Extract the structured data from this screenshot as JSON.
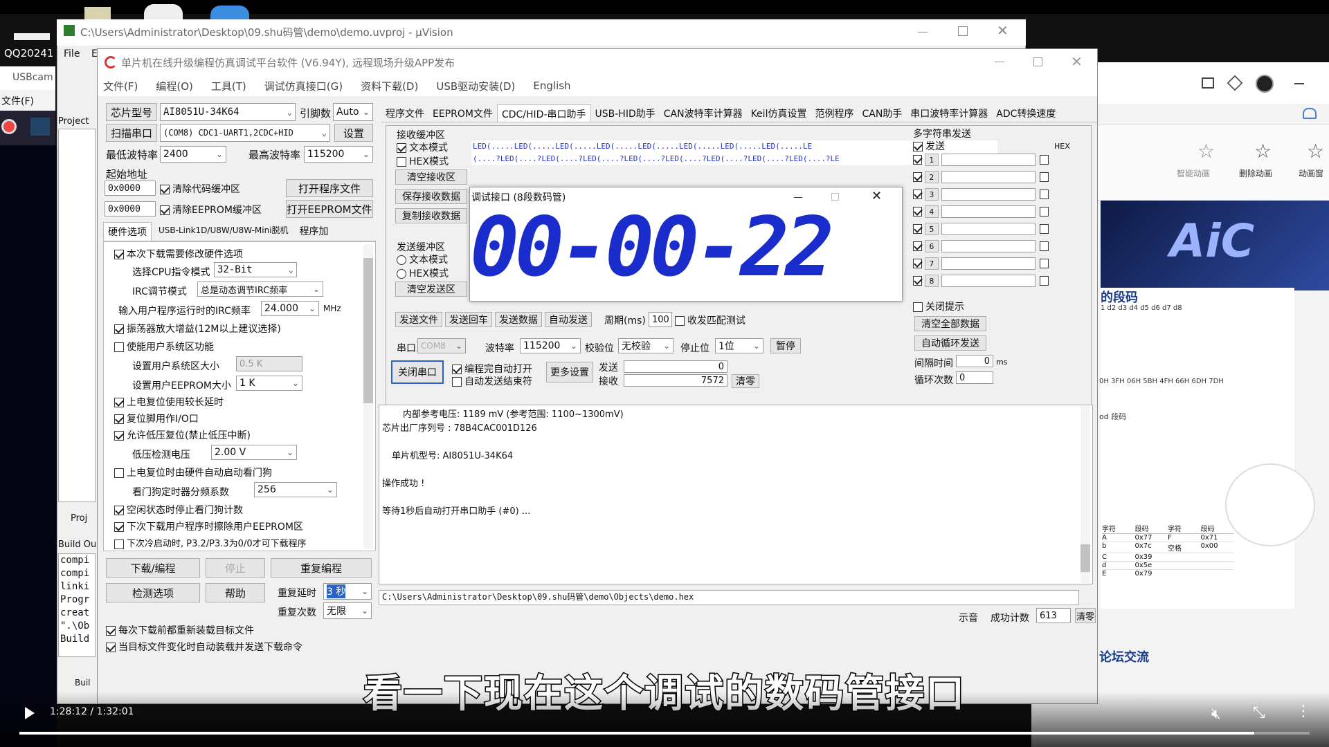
{
  "desktop": {
    "qq_label": "QQ20241",
    "usbcam_label": "USBcam",
    "filemenu": "文件(F)",
    "settings": "设"
  },
  "uv": {
    "title": "C:\\Users\\Administrator\\Desktop\\09.shu码管\\demo\\demo.uvproj - µVision",
    "menu_file": "File",
    "menu_e": "E",
    "project": "Project",
    "build": "Build Ou",
    "proj_tab": "Proj",
    "build_lines": [
      "compi",
      "compi",
      "linki",
      "Progr",
      "creat",
      "\".\\Ob",
      "Build"
    ],
    "build_tab": "Buil"
  },
  "stc": {
    "title": "单片机在线升级编程仿真调试平台软件 (V6.94Y), 远程现场升级APP发布",
    "menu": [
      "文件(F)",
      "编程(O)",
      "工具(T)",
      "调试仿真接口(G)",
      "资料下载(D)",
      "USB驱动安装(D)",
      "English"
    ],
    "chip_btn": "芯片型号",
    "chip_val": "AI8051U-34K64",
    "pin_label": "引脚数",
    "pin_val": "Auto",
    "scan_btn": "扫描串口",
    "port_val": "(COM8) CDC1-UART1,2CDC+HID",
    "settings_btn": "设置",
    "min_baud_label": "最低波特率",
    "min_baud": "2400",
    "max_baud_label": "最高波特率",
    "max_baud": "115200",
    "start_addr": "起始地址",
    "addr1": "0x0000",
    "clear_code": "清除代码缓冲区",
    "open_prog": "打开程序文件",
    "addr2": "0x0000",
    "clear_eeprom": "清除EEPROM缓冲区",
    "open_eeprom": "打开EEPROM文件",
    "sub_tabs": [
      "硬件选项",
      "USB-Link1D/U8W/U8W-Mini脱机",
      "程序加"
    ],
    "opt_modify": "本次下载需要修改硬件选项",
    "cpu_mode_label": "选择CPU指令模式",
    "cpu_mode": "32-Bit",
    "irc_mode_label": "IRC调节模式",
    "irc_mode": "总是动态调节IRC频率",
    "irc_freq_label": "输入用户程序运行时的IRC频率",
    "irc_freq": "24.000",
    "mhz": "MHz",
    "osc_gain": "振荡器放大增益(12M以上建议选择)",
    "user_sys": "使能用户系统区功能",
    "user_sys_size_label": "设置用户系统区大小",
    "user_sys_size": "0.5 K",
    "user_eeprom_label": "设置用户EEPROM大小",
    "user_eeprom": "1 K",
    "long_delay": "上电复位使用较长延时",
    "reset_io": "复位脚用作I/O口",
    "lvd_reset": "允许低压复位(禁止低压中断)",
    "lvd_label": "低压检测电压",
    "lvd_val": "2.00 V",
    "wdt_auto": "上电复位时由硬件自动启动看门狗",
    "wdt_div_label": "看门狗定时器分频系数",
    "wdt_div": "256",
    "idle_wdt": "空闲状态时停止看门狗计数",
    "erase_eeprom": "下次下载用户程序时擦除用户EEPROM区",
    "cold_boot": "下次冷启动时, P3.2/P3.3为0/0才可下载程序",
    "download_btn": "下载/编程",
    "stop_btn": "停止",
    "reprog_btn": "重复编程",
    "check_btn": "检测选项",
    "help_btn": "帮助",
    "repeat_delay_label": "重复延时",
    "repeat_delay": "3 秒",
    "repeat_count_label": "重复次数",
    "repeat_count": "无限",
    "reload_each": "每次下载前都重新装载目标文件",
    "auto_send": "当目标文件变化时自动装载并发送下载命令",
    "right_tabs": [
      "程序文件",
      "EEPROM文件",
      "CDC/HID-串口助手",
      "USB-HID助手",
      "CAN波特率计算器",
      "Keil仿真设置",
      "范例程序",
      "CAN助手",
      "串口波特率计算器",
      "ADC转换速度"
    ],
    "recv_title": "接收缓冲区",
    "text_mode": "文本模式",
    "hex_mode": "HEX模式",
    "clear_recv": "清空接收区",
    "save_recv": "保存接收数据",
    "copy_recv": "复制接收数据",
    "recv_line1": "LED(.....LED(.....LED(.....LED(.....LED(.....LED(.....LED(.....LED(.....LE",
    "recv_line2": "(....?LED(....?LED(....?LED(....?LED(....?LED(....?LED(....?LED(....?LED(....?LE",
    "send_title": "发送缓冲区",
    "send_text_mode": "文本模式",
    "send_hex_mode": "HEX模式",
    "clear_send": "清空发送区",
    "send_file": "发送文件",
    "send_enter": "发送回车",
    "send_data": "发送数据",
    "auto_send_btn": "自动发送",
    "period_label": "周期(ms)",
    "period": "100",
    "recv_match": "收发匹配测试",
    "port_label": "串口",
    "port": "COM8",
    "baud_label": "波特率",
    "baud": "115200",
    "parity_label": "校验位",
    "parity": "无校验",
    "stop_label": "停止位",
    "stopbits": "1位",
    "pause": "暂停",
    "close_port": "关闭串口",
    "auto_open": "编程完自动打开",
    "auto_end": "自动发送结束符",
    "more_settings": "更多设置",
    "sent_label": "发送",
    "sent_val": "0",
    "recv_label": "接收",
    "recv_val": "7572",
    "clear_counts": "清零",
    "multi_title": "多字符串发送",
    "multi_send": "发送",
    "hex_col": "HEX",
    "multi_rows": [
      "1",
      "2",
      "3",
      "4",
      "5",
      "6",
      "7",
      "8"
    ],
    "close_hint": "关闭提示",
    "clear_all": "清空全部数据",
    "auto_loop": "自动循环发送",
    "interval_label": "间隔时间",
    "interval": "0",
    "ms": "ms",
    "loop_label": "循环次数",
    "loop": "0",
    "log": [
      "内部参考电压: 1189 mV (参考范围: 1100~1300mV)",
      "芯片出厂序列号 : 78B4CAC001D126",
      "单片机型号: AI8051U-34K64",
      "操作成功 !",
      "等待1秒后自动打开串口助手 (#0) ..."
    ],
    "path_line": "C:\\Users\\Administrator\\Desktop\\09.shu码管\\demo\\Objects\\demo.hex",
    "prompt_tail": "示音",
    "success_label": "成功计数",
    "success_val": "613",
    "clear_bottom": "清零"
  },
  "seg_window": {
    "title": "调试接口 (8段数码管)",
    "display": "00-00-22"
  },
  "right_app": {
    "tools": [
      "智能动画",
      "删除动画",
      "动画窗"
    ],
    "heading": "的段码",
    "dlist": "1 d2 d3 d4 d5 d6 d7 d8",
    "hexrow": "0H 3FH 06H 5BH 4FH 66H 6DH 7DH",
    "code_label": "od 段码",
    "table_head": [
      "字符",
      "段码",
      "字符",
      "段码"
    ],
    "table_rows": [
      [
        "A",
        "0x77",
        "F",
        "0x71"
      ],
      [
        "b",
        "0x7c",
        "空格",
        "0x00"
      ],
      [
        "C",
        "0x39",
        "",
        ""
      ],
      [
        "d",
        "0x5e",
        "",
        ""
      ],
      [
        "E",
        "0x79",
        "",
        ""
      ]
    ],
    "forum": "论坛交流"
  },
  "video": {
    "time": "1:28:12 / 1:32:01",
    "progress": 0.957
  },
  "subtitle": "看一下现在这个调试的数码管接口"
}
